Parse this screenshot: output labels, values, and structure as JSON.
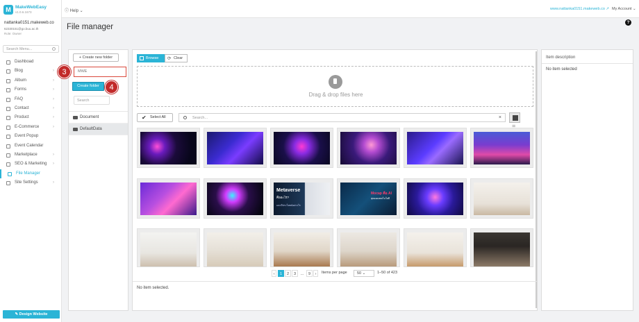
{
  "sidebar": {
    "logo_letter": "M",
    "brand": "MakeWebEasy",
    "version": "v1.0.6.1673",
    "user_name": "nattanka0151.makeweb.co",
    "user_email": "62330151@go.buu.ac.th",
    "user_role": "Role: Owner",
    "search_placeholder": "Search Menu...",
    "items": [
      {
        "label": "Dashboad",
        "icon": "dashboard-icon",
        "chevron": ""
      },
      {
        "label": "Blog",
        "icon": "blog-icon",
        "chevron": "›"
      },
      {
        "label": "Album",
        "icon": "album-icon",
        "chevron": "›"
      },
      {
        "label": "Forms",
        "icon": "forms-icon",
        "chevron": "›"
      },
      {
        "label": "FAQ",
        "icon": "faq-icon",
        "chevron": "›"
      },
      {
        "label": "Contact",
        "icon": "contact-icon",
        "chevron": "›"
      },
      {
        "label": "Product",
        "icon": "product-icon",
        "chevron": "›"
      },
      {
        "label": "E-Commerce",
        "icon": "ecommerce-icon",
        "chevron": "›"
      },
      {
        "label": "Event Popup",
        "icon": "popup-icon",
        "chevron": ""
      },
      {
        "label": "Event Calendar",
        "icon": "calendar-icon",
        "chevron": ""
      },
      {
        "label": "Marketplace",
        "icon": "marketplace-icon",
        "chevron": "›"
      },
      {
        "label": "SEO & Marketing",
        "icon": "seo-icon",
        "chevron": "›"
      },
      {
        "label": "File Manager",
        "icon": "folder-icon",
        "chevron": "",
        "active": true
      },
      {
        "label": "Site Settings",
        "icon": "gear-icon",
        "chevron": "›"
      }
    ],
    "design_button": "✎ Design Website"
  },
  "topbar": {
    "help": "ⓘ Help ⌄",
    "site_link": "www.nattanka0151.makeweb.co ↗",
    "account": "My Account ⌄"
  },
  "page": {
    "title": "File manager",
    "help_icon": "?"
  },
  "folders": {
    "new_folder_button": "+ Create new folder",
    "new_folder_value": "MWE",
    "create_button": "Create folder",
    "search_placeholder": "Search",
    "items": [
      {
        "label": "Document",
        "selected": false
      },
      {
        "label": "DefaultData",
        "selected": true
      }
    ],
    "step_badges": [
      "3",
      "4"
    ]
  },
  "main": {
    "browse_tab": "Browse",
    "clear_tab": "Clear",
    "clear_icon": "⟳",
    "dropzone_text": "Drag & drop files here",
    "select_all": "Select All",
    "select_all_icon": "✔",
    "search_placeholder": "Search...",
    "clear_search": "×",
    "list_toggle": "☰",
    "pagination": {
      "prev": "‹",
      "pages": [
        "1",
        "2",
        "3",
        "...",
        "9"
      ],
      "next": "›",
      "per_page_label": "Items per page",
      "per_page_value": "50",
      "range": "1–50 of 423"
    },
    "status": "No item selected."
  },
  "details": {
    "header": "Item description",
    "value": "No item selected"
  },
  "colors": {
    "accent": "#2bb4d6",
    "badge": "#c22a2a"
  },
  "thumbnails": [
    {
      "name": "thumb-neon-abstract"
    },
    {
      "name": "thumb-isometric-vr"
    },
    {
      "name": "thumb-neon-vr-head"
    },
    {
      "name": "thumb-vr-user-purple"
    },
    {
      "name": "thumb-isometric-desk"
    },
    {
      "name": "thumb-gaming-setup"
    },
    {
      "name": "thumb-vr-avatar-pink"
    },
    {
      "name": "thumb-vr-woman-neon"
    },
    {
      "name": "thumb-metaverse-banner"
    },
    {
      "name": "thumb-mocap-ai-banner"
    },
    {
      "name": "thumb-hologram-purple"
    },
    {
      "name": "thumb-white-room-plant"
    },
    {
      "name": "thumb-chair-plant"
    },
    {
      "name": "thumb-white-cabinet"
    },
    {
      "name": "thumb-wood-dining"
    },
    {
      "name": "thumb-grey-armchair"
    },
    {
      "name": "thumb-wood-chair-plant"
    },
    {
      "name": "thumb-tv-living-room"
    }
  ],
  "metaverse_banner": {
    "title": "Metaverse",
    "subtitle": "คืออะไร?",
    "caption": "และมีประโยชน์อย่างไร"
  },
  "mocap_banner": {
    "title": "Mocap คือ AI",
    "caption": "สุดยอดเทคโนโลยี"
  }
}
